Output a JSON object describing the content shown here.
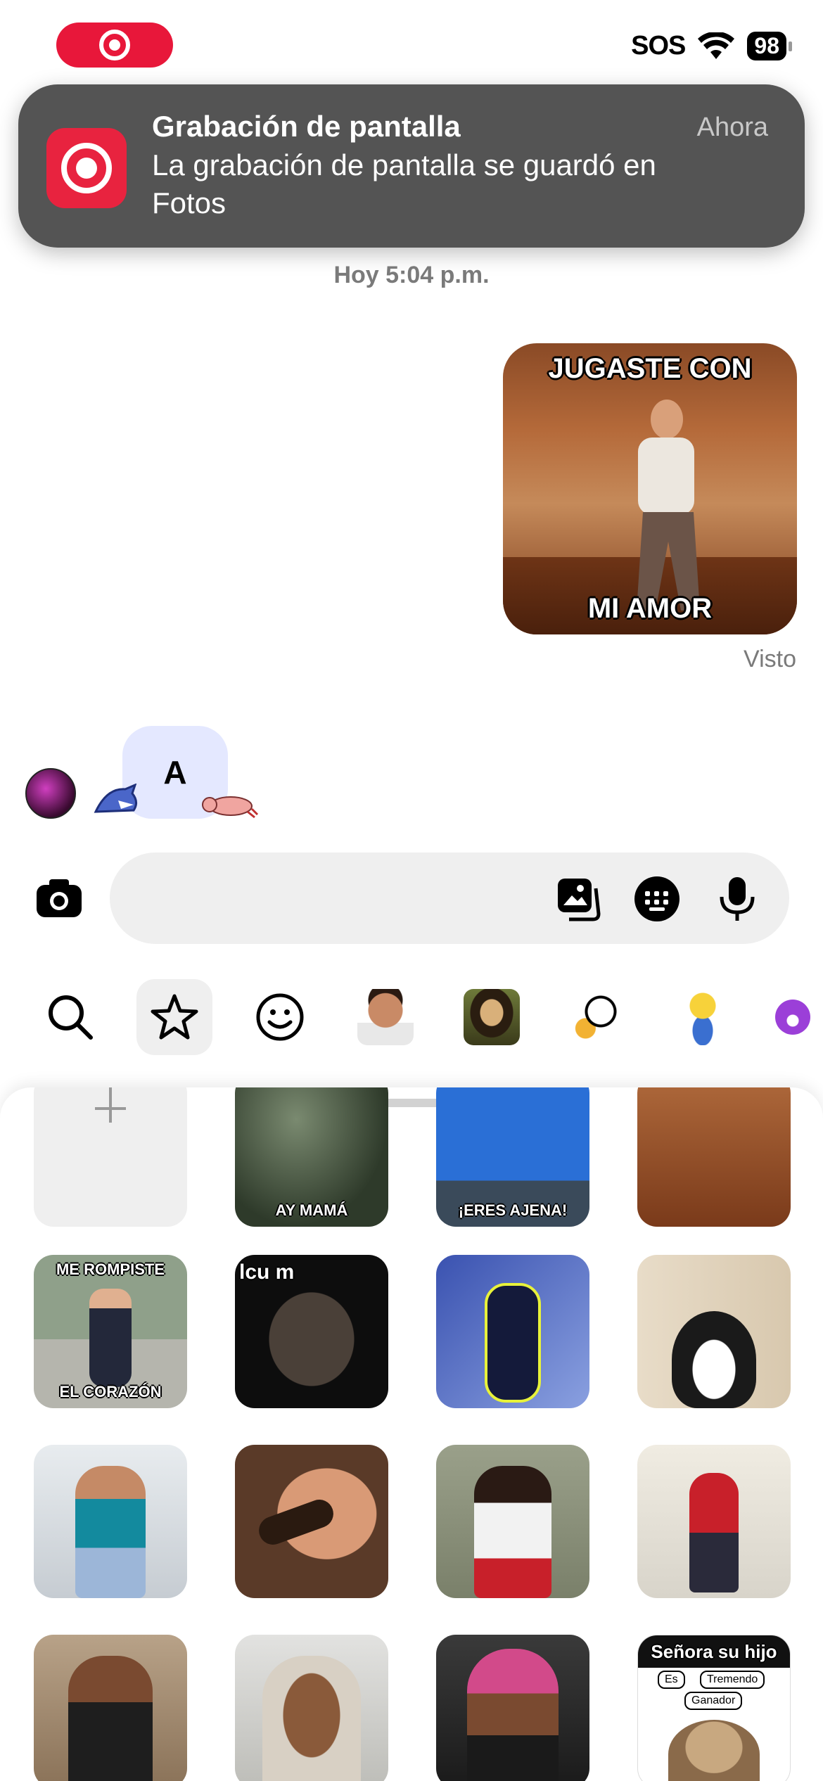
{
  "status_bar": {
    "sos": "SOS",
    "battery": "98"
  },
  "notification": {
    "title": "Grabación de pantalla",
    "time": "Ahora",
    "body": "La grabación de pantalla se guardó en Fotos"
  },
  "thread": {
    "timestamp": "Hoy 5:04 p.m.",
    "sent_gif": {
      "caption_top": "JUGASTE CON",
      "caption_bottom": "MI AMOR"
    },
    "seen_label": "Visto",
    "incoming_bubble": "A"
  },
  "composer": {
    "placeholder": ""
  },
  "sticker_tabs": [
    "search-icon",
    "star-icon",
    "smiley-icon",
    "avatar-sticker",
    "mona-lisa-sticker",
    "cartoon-sticker",
    "yellow-character-sticker",
    "purple-face-sticker"
  ],
  "gif_captions": {
    "row0_col1": "AY MAMÁ",
    "row0_col2": "¡ERES AJENA!",
    "row1_col0_top": "ME ROMPISTE",
    "row1_col0_bottom": "EL CORAZÓN",
    "row1_col1_top": "lcu   m",
    "row3_col3_title": "Señora su hijo",
    "row3_col3_es": "Es",
    "row3_col3_tremendo": "Tremendo",
    "row3_col3_ganador": "Ganador"
  },
  "colors": {
    "record_red": "#e8173a",
    "banner_bg": "#545454",
    "bubble_bg": "#e4e8ff",
    "composer_bg": "#efefef"
  }
}
